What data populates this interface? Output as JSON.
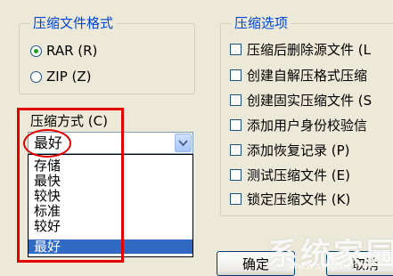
{
  "archive_format": {
    "title": "压缩文件格式",
    "options": [
      {
        "label": "RAR (R)",
        "checked": true
      },
      {
        "label": "ZIP (Z)",
        "checked": false
      }
    ]
  },
  "compression_method": {
    "label": "压缩方式 (C)",
    "selected": "最好",
    "options": [
      "存储",
      "最快",
      "较快",
      "标准",
      "较好",
      "最好"
    ],
    "selected_index": 5
  },
  "compression_options": {
    "title": "压缩选项",
    "items": [
      "压缩后删除源文件 (L",
      "创建自解压格式压缩",
      "创建固实压缩文件 (S",
      "添加用户身份校验信",
      "添加恢复记录 (P)",
      "测试压缩文件 (E)",
      "锁定压缩文件 (K)"
    ]
  },
  "buttons": {
    "ok": "确定",
    "cancel": "取消"
  },
  "watermark": {
    "text": "系统家园",
    "url": "www.sysjia.com"
  },
  "colors": {
    "dialog_bg": "#ECE9D8",
    "group_title": "#0046D5",
    "highlight": "#316AC5",
    "annotation_red": "#E50000"
  }
}
